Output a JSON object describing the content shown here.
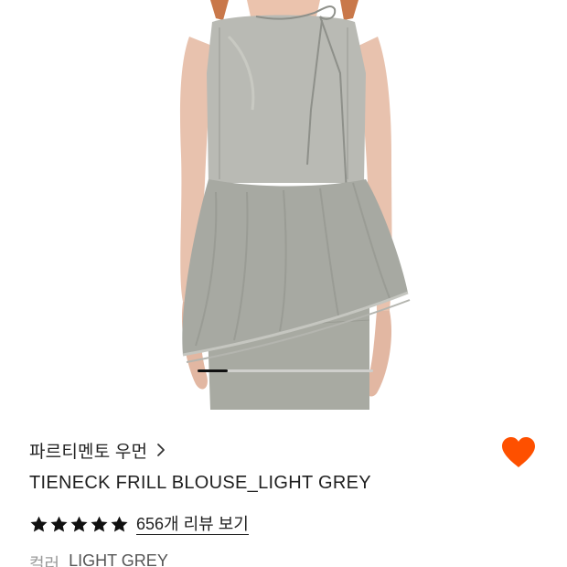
{
  "gallery": {
    "image_label": "TIENECK FRILL BLOUSE_LIGHT GREY",
    "progress": 0.17
  },
  "product": {
    "brand": "파르티멘토 우먼",
    "title": "TIENECK FRILL BLOUSE_LIGHT GREY",
    "rating_stars": 5,
    "review_link": "656개 리뷰 보기",
    "color_label": "컬러",
    "color_value": "LIGHT GREY"
  },
  "colors": {
    "heart": "#fe5000",
    "star": "#111111",
    "progress_fill": "#111111",
    "progress_track": "#cfcfcc"
  },
  "icons": {
    "chevron": "chevron-right-icon",
    "wishlist": "heart-icon",
    "rating": "star-icon"
  }
}
